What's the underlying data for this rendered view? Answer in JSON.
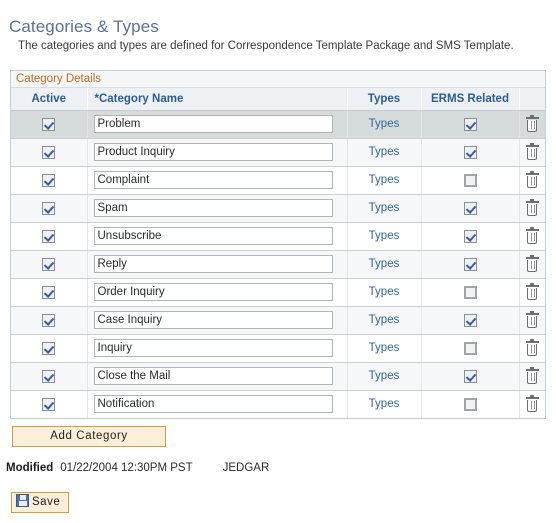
{
  "page": {
    "title": "Categories & Types",
    "description": "The categories and types are defined for Correspondence Template Package and SMS Template."
  },
  "panel": {
    "header": "Category Details"
  },
  "grid": {
    "columns": {
      "active": "Active",
      "name": "*Category Name",
      "types": "Types",
      "erms": "ERMS Related",
      "delete": ""
    },
    "rows": [
      {
        "active": true,
        "name": "Problem",
        "types_label": "Types",
        "erms": true,
        "selected": true
      },
      {
        "active": true,
        "name": "Product Inquiry",
        "types_label": "Types",
        "erms": true,
        "selected": false
      },
      {
        "active": true,
        "name": "Complaint",
        "types_label": "Types",
        "erms": false,
        "selected": false
      },
      {
        "active": true,
        "name": "Spam",
        "types_label": "Types",
        "erms": true,
        "selected": false
      },
      {
        "active": true,
        "name": "Unsubscribe",
        "types_label": "Types",
        "erms": true,
        "selected": false
      },
      {
        "active": true,
        "name": "Reply",
        "types_label": "Types",
        "erms": true,
        "selected": false
      },
      {
        "active": true,
        "name": "Order Inquiry",
        "types_label": "Types",
        "erms": false,
        "selected": false
      },
      {
        "active": true,
        "name": "Case Inquiry",
        "types_label": "Types",
        "erms": true,
        "selected": false
      },
      {
        "active": true,
        "name": "Inquiry",
        "types_label": "Types",
        "erms": false,
        "selected": false
      },
      {
        "active": true,
        "name": "Close the Mail",
        "types_label": "Types",
        "erms": true,
        "selected": false
      },
      {
        "active": true,
        "name": "Notification",
        "types_label": "Types",
        "erms": false,
        "selected": false
      }
    ]
  },
  "actions": {
    "add_category": "Add Category",
    "save": "Save"
  },
  "modified": {
    "label": "Modified",
    "timestamp": "01/22/2004 12:30PM PST",
    "user": "JEDGAR"
  },
  "colors": {
    "title": "#5c7099",
    "panel_header_text": "#c06a1f",
    "column_header_text": "#2c5d92",
    "link": "#31629e",
    "button_face": "#fcefd9",
    "button_border": "#d69b46",
    "selected_row": "#d6dcdc"
  },
  "icons": {
    "delete": "trash-icon",
    "save": "floppy-disk-icon"
  }
}
